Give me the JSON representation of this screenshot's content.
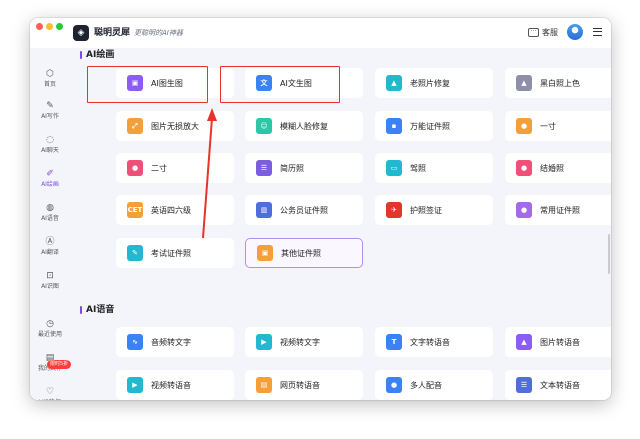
{
  "app": {
    "name": "聪明灵犀",
    "slogan": "更聪明的AI神器",
    "logo_glyph": "◈"
  },
  "header": {
    "customer_service": "客服",
    "icons": [
      "chat-bubble-icon",
      "avatar",
      "menu-icon"
    ]
  },
  "sidebar": {
    "items": [
      {
        "label": "首页",
        "icon": "⬡",
        "active": false
      },
      {
        "label": "AI写作",
        "icon": "✎",
        "active": false
      },
      {
        "label": "AI聊天",
        "icon": "◌",
        "active": false
      },
      {
        "label": "AI绘画",
        "icon": "✐",
        "active": true
      },
      {
        "label": "AI语音",
        "icon": "◍",
        "active": false
      },
      {
        "label": "AI翻译",
        "icon": "Ⓐ",
        "active": false
      },
      {
        "label": "AI识图",
        "icon": "⊡",
        "active": false
      },
      {
        "label": "最近使用",
        "icon": "◷",
        "active": false
      },
      {
        "label": "我的文件",
        "icon": "▤",
        "active": false
      },
      {
        "label": "VIP特权",
        "icon": "♡",
        "active": false
      }
    ],
    "badge": "限时5折"
  },
  "sections": [
    {
      "title": "AI绘画",
      "cards": [
        {
          "label": "AI图生图",
          "color": "#8b5cf6",
          "glyph": "▣",
          "highlighted": false
        },
        {
          "label": "AI文生图",
          "color": "#3b82f6",
          "glyph": "文",
          "highlighted": false
        },
        {
          "label": "老照片修复",
          "color": "#22b8cf",
          "glyph": "▲",
          "highlighted": false
        },
        {
          "label": "黑白照上色",
          "color": "#8e8fa8",
          "glyph": "▲",
          "highlighted": false
        },
        {
          "label": "图片无损放大",
          "color": "#f59f3a",
          "glyph": "⤢",
          "highlighted": false
        },
        {
          "label": "模糊人脸修复",
          "color": "#2cc7a6",
          "glyph": "☺",
          "highlighted": false
        },
        {
          "label": "万能证件照",
          "color": "#3b82f6",
          "glyph": "▪",
          "highlighted": false
        },
        {
          "label": "一寸",
          "color": "#f59f3a",
          "glyph": "●",
          "highlighted": false
        },
        {
          "label": "二寸",
          "color": "#f04f78",
          "glyph": "●",
          "highlighted": false
        },
        {
          "label": "简历照",
          "color": "#7c5ce0",
          "glyph": "☰",
          "highlighted": false
        },
        {
          "label": "驾照",
          "color": "#22b8cf",
          "glyph": "▭",
          "highlighted": false
        },
        {
          "label": "结婚照",
          "color": "#f04f78",
          "glyph": "●",
          "highlighted": false
        },
        {
          "label": "英语四六级",
          "color": "#f59f3a",
          "glyph": "CET",
          "highlighted": false
        },
        {
          "label": "公务员证件照",
          "color": "#4f6edb",
          "glyph": "▥",
          "highlighted": false
        },
        {
          "label": "护照签证",
          "color": "#e5342a",
          "glyph": "✈",
          "highlighted": false
        },
        {
          "label": "常用证件照",
          "color": "#a56ae8",
          "glyph": "●",
          "highlighted": false
        },
        {
          "label": "考试证件照",
          "color": "#22b8cf",
          "glyph": "✎",
          "highlighted": false
        },
        {
          "label": "其他证件照",
          "color": "#f59f3a",
          "glyph": "▣",
          "highlighted": true
        }
      ]
    },
    {
      "title": "AI语音",
      "cards": [
        {
          "label": "音频转文字",
          "color": "#3b82f6",
          "glyph": "∿",
          "highlighted": false
        },
        {
          "label": "视频转文字",
          "color": "#22b8cf",
          "glyph": "▶",
          "highlighted": false
        },
        {
          "label": "文字转语音",
          "color": "#3b82f6",
          "glyph": "T",
          "highlighted": false
        },
        {
          "label": "图片转语音",
          "color": "#8b5cf6",
          "glyph": "▲",
          "highlighted": false
        },
        {
          "label": "视频转语音",
          "color": "#22b8cf",
          "glyph": "▶",
          "highlighted": false
        },
        {
          "label": "网页转语音",
          "color": "#f59f3a",
          "glyph": "▤",
          "highlighted": false
        },
        {
          "label": "多人配音",
          "color": "#3b82f6",
          "glyph": "●",
          "highlighted": false
        },
        {
          "label": "文本转语音",
          "color": "#4f6edb",
          "glyph": "☰",
          "highlighted": false
        }
      ]
    }
  ],
  "annotations": {
    "box_color": "#e5342a",
    "arrow_color": "#e5342a"
  }
}
